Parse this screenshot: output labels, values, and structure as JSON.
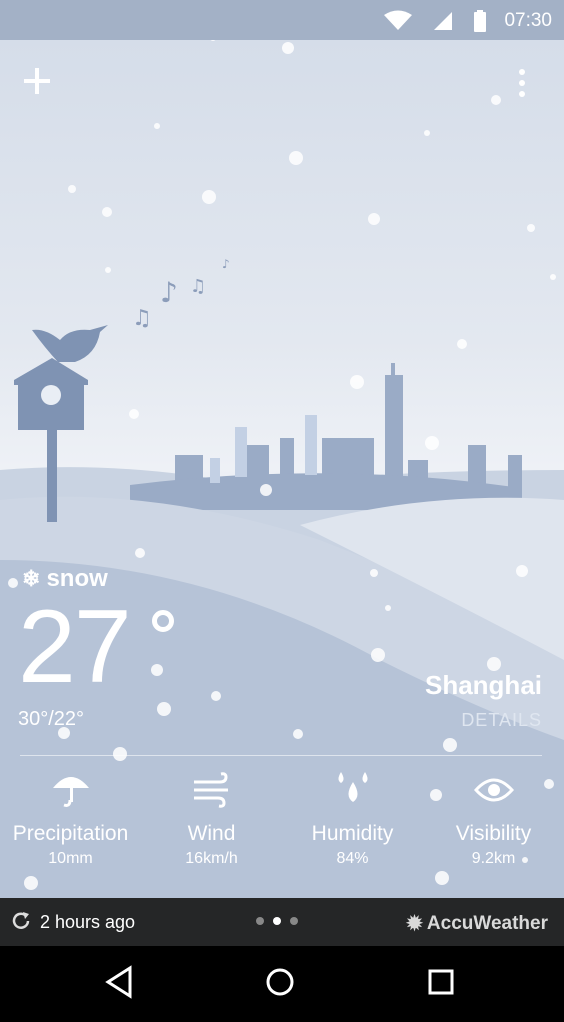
{
  "status_bar": {
    "time": "07:30",
    "icons": [
      "wifi-icon",
      "signal-icon",
      "battery-icon"
    ]
  },
  "header": {
    "add_icon": "plus-icon",
    "menu_icon": "more-vert-icon"
  },
  "weather": {
    "condition": "snow",
    "condition_icon": "snowflake-icon",
    "temperature": "27",
    "high_low": "30°/22°",
    "city": "Shanghai",
    "details_label": "DETAILS"
  },
  "metrics": [
    {
      "label": "Precipitation",
      "value": "10mm",
      "icon": "umbrella-icon"
    },
    {
      "label": "Wind",
      "value": "16km/h",
      "icon": "wind-icon"
    },
    {
      "label": "Humidity",
      "value": "84%",
      "icon": "droplets-icon"
    },
    {
      "label": "Visibility",
      "value": "9.2km",
      "icon": "eye-icon"
    }
  ],
  "footer": {
    "updated": "2 hours ago",
    "brand": "AccuWeather",
    "pages": 3,
    "active_page": 2
  },
  "colors": {
    "sky": "#e3e8f0",
    "hill": "#b9c5d8",
    "silhouette": "#94a7c4",
    "footer": "#252627"
  }
}
